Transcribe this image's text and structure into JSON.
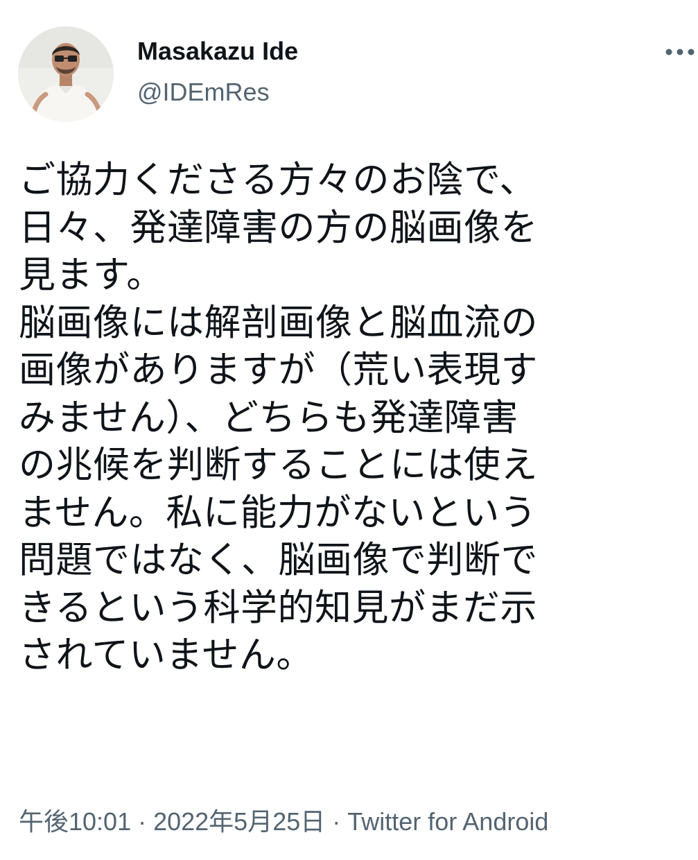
{
  "author": {
    "display_name": "Masakazu Ide",
    "handle": "@IDEmRes"
  },
  "menu": {
    "more_icon": "more-horizontal-icon"
  },
  "tweet": {
    "lines": [
      "ご協力くださる方々のお陰で、",
      "日々、発達障害の方の脳画像を",
      "見ます。",
      "脳画像には解剖画像と脳血流の",
      "画像がありますが（荒い表現す",
      "みません）、どちらも発達障害",
      "の兆候を判断することには使え",
      "ません。私に能力がないという",
      "問題ではなく、脳画像で判断で",
      "きるという科学的知見がまだ示",
      "されていません。"
    ]
  },
  "meta": {
    "time": "午後10:01",
    "separator": "·",
    "date": "2022年5月25日",
    "source": "Twitter for Android"
  },
  "colors": {
    "text": "#0f1419",
    "secondary": "#536471",
    "background": "#ffffff"
  }
}
